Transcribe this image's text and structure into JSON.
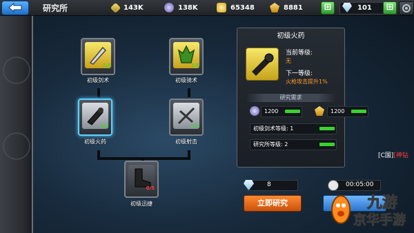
{
  "header": {
    "title": "研究所",
    "resources": [
      {
        "icon": "gold-ore-icon",
        "value": "143K"
      },
      {
        "icon": "purple-ore-icon",
        "value": "138K"
      },
      {
        "icon": "gold-coin-icon",
        "value": "65348"
      },
      {
        "icon": "gold-gem-icon",
        "value": "8881"
      }
    ],
    "diamonds": "101"
  },
  "tree": {
    "nodes": [
      {
        "id": "sword",
        "label": "初级剑术",
        "progress": "1/5"
      },
      {
        "id": "riding",
        "label": "初级骑术",
        "progress": "1/5"
      },
      {
        "id": "gun",
        "label": "初级火药",
        "progress": "0/5"
      },
      {
        "id": "shooting",
        "label": "初级射击",
        "progress": "0/5"
      },
      {
        "id": "speed",
        "label": "初级迅捷",
        "progress": "0/5"
      }
    ]
  },
  "panel": {
    "title": "初级火药",
    "current_label": "当前等级:",
    "current_value": "无",
    "next_label": "下一等级:",
    "next_value": "火枪攻击提升1%",
    "requirements_header": "研究需求",
    "cost_purple": "1200",
    "cost_gold": "1200",
    "req1": "初级剑术等级: 1",
    "req2": "研究所等级: 2"
  },
  "side_text": {
    "prefix": "[C国]",
    "suffix": "[神钻"
  },
  "bottom": {
    "gem_cost": "8",
    "time": "00:05:00",
    "research_button": "立即研究"
  },
  "watermark": {
    "line1": "九游",
    "line2": "京华手游"
  },
  "colors": {
    "accent_orange": "#ff9a2a",
    "selected_blue": "#5fd0ff",
    "progress_green": "#3bd230"
  }
}
